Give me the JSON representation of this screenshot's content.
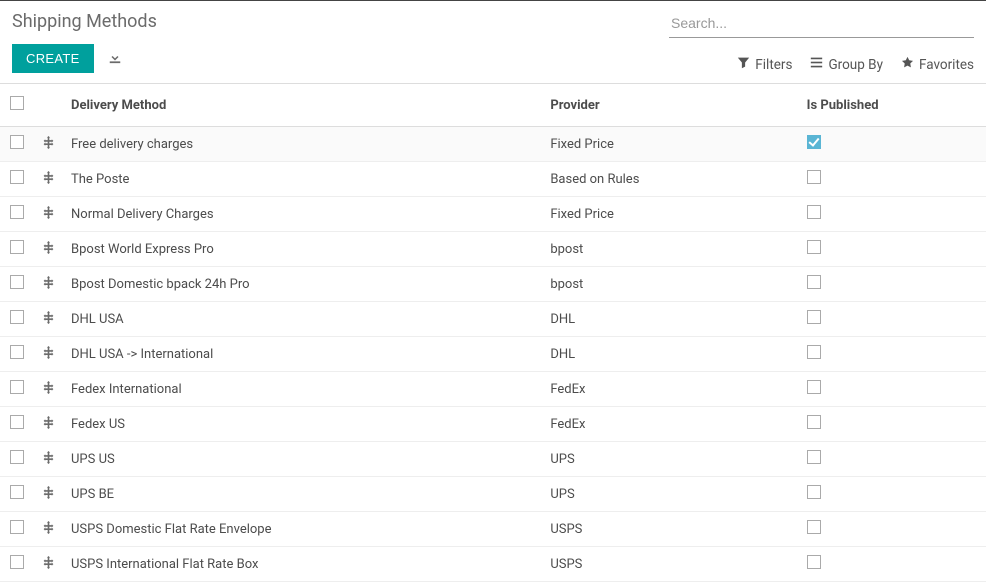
{
  "page_title": "Shipping Methods",
  "buttons": {
    "create_label": "CREATE"
  },
  "search": {
    "placeholder": "Search...",
    "options": {
      "filters": "Filters",
      "group_by": "Group By",
      "favorites": "Favorites"
    }
  },
  "columns": {
    "delivery_method": "Delivery Method",
    "provider": "Provider",
    "is_published": "Is Published"
  },
  "rows": [
    {
      "method": "Free delivery charges",
      "provider": "Fixed Price",
      "published": true,
      "highlight": true
    },
    {
      "method": "The Poste",
      "provider": "Based on Rules",
      "published": false
    },
    {
      "method": "Normal Delivery Charges",
      "provider": "Fixed Price",
      "published": false
    },
    {
      "method": "Bpost World Express Pro",
      "provider": "bpost",
      "published": false
    },
    {
      "method": "Bpost Domestic bpack 24h Pro",
      "provider": "bpost",
      "published": false
    },
    {
      "method": "DHL USA",
      "provider": "DHL",
      "published": false
    },
    {
      "method": "DHL USA -> International",
      "provider": "DHL",
      "published": false
    },
    {
      "method": "Fedex International",
      "provider": "FedEx",
      "published": false
    },
    {
      "method": "Fedex US",
      "provider": "FedEx",
      "published": false
    },
    {
      "method": "UPS US",
      "provider": "UPS",
      "published": false
    },
    {
      "method": "UPS BE",
      "provider": "UPS",
      "published": false
    },
    {
      "method": "USPS Domestic Flat Rate Envelope",
      "provider": "USPS",
      "published": false
    },
    {
      "method": "USPS International Flat Rate Box",
      "provider": "USPS",
      "published": false
    }
  ]
}
